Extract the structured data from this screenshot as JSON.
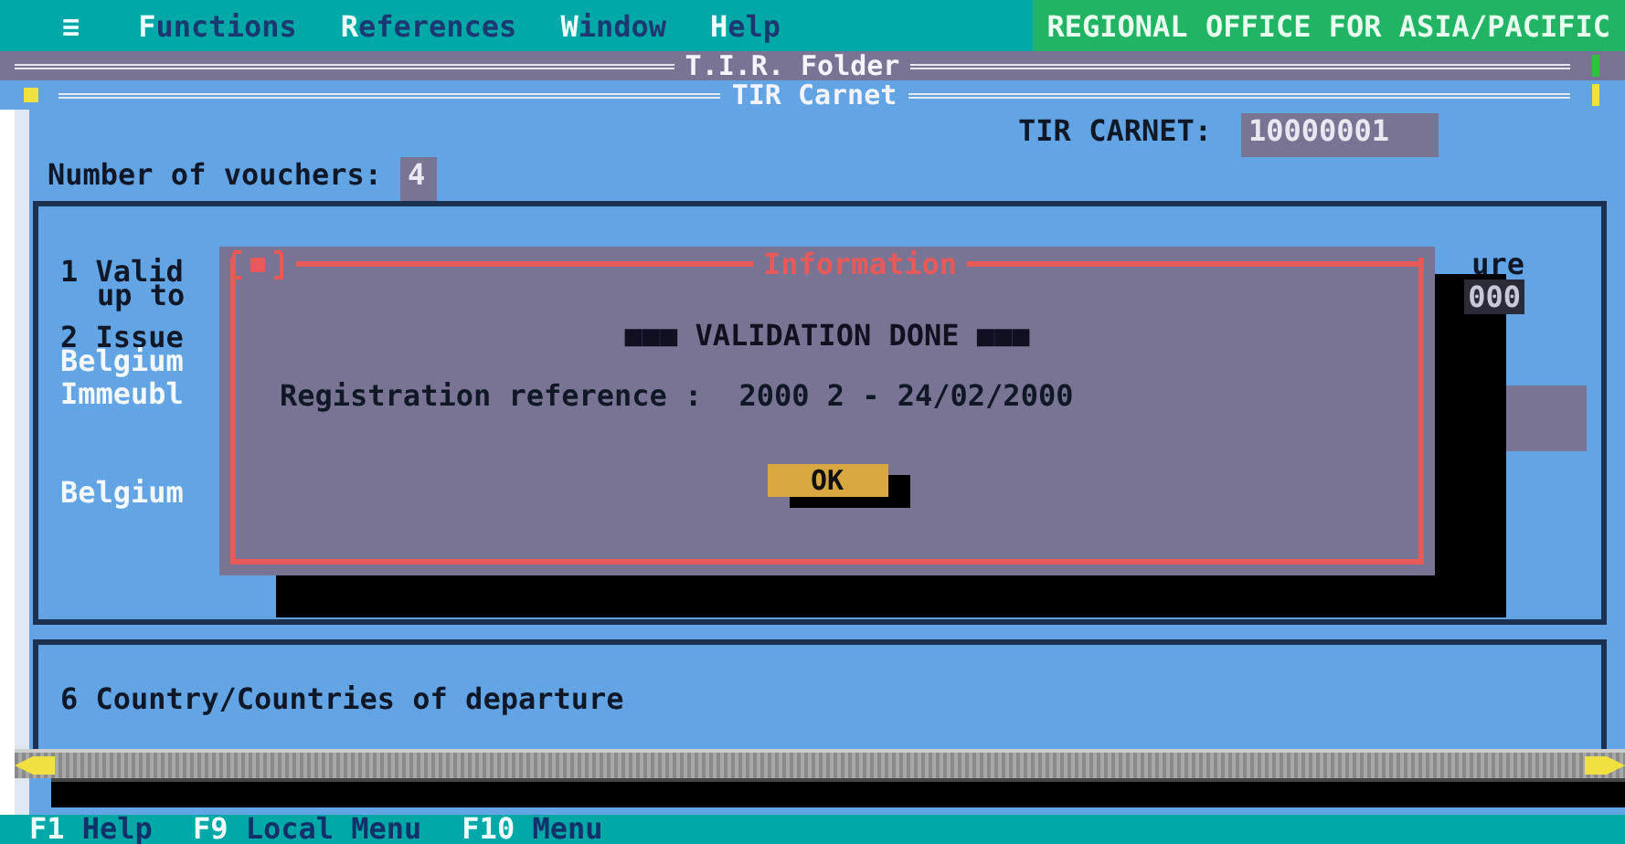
{
  "menu_bar": {
    "system_icon": "≡",
    "items": [
      {
        "label": "Functions"
      },
      {
        "label": "References"
      },
      {
        "label": "Window"
      },
      {
        "label": "Help"
      }
    ],
    "title": "REGIONAL OFFICE FOR ASIA/PACIFIC"
  },
  "folder_window": {
    "title": "T.I.R. Folder"
  },
  "carnet_window": {
    "title": "TIR Carnet",
    "carnet_label": "TIR CARNET:",
    "carnet_number": "10000001",
    "vouchers_label": "Number of vouchers:",
    "vouchers_value": "4"
  },
  "form_panel": {
    "rows": [
      {
        "kind": "heading",
        "text": "1 Valid",
        "right_text": "ure"
      },
      {
        "kind": "sub",
        "text": "up to",
        "right_field": "000"
      },
      {
        "kind": "heading",
        "text": "2 Issue"
      },
      {
        "kind": "address",
        "text": "Belgium"
      },
      {
        "kind": "address",
        "text": "Immeubl"
      },
      {
        "kind": "gap"
      },
      {
        "kind": "address",
        "text": "Belgium"
      }
    ]
  },
  "departure_panel": {
    "label": "6 Country/Countries of departure"
  },
  "dialog": {
    "title": "Information",
    "message": "■■■ VALIDATION DONE ■■■",
    "reference_label": "Registration reference :",
    "reference_value": "2000 2 - 24/02/2000",
    "button": "OK"
  },
  "status_bar": [
    {
      "key": "F1",
      "label": "Help"
    },
    {
      "key": "F9",
      "label": "Local Menu"
    },
    {
      "key": "F10",
      "label": "Menu"
    }
  ]
}
